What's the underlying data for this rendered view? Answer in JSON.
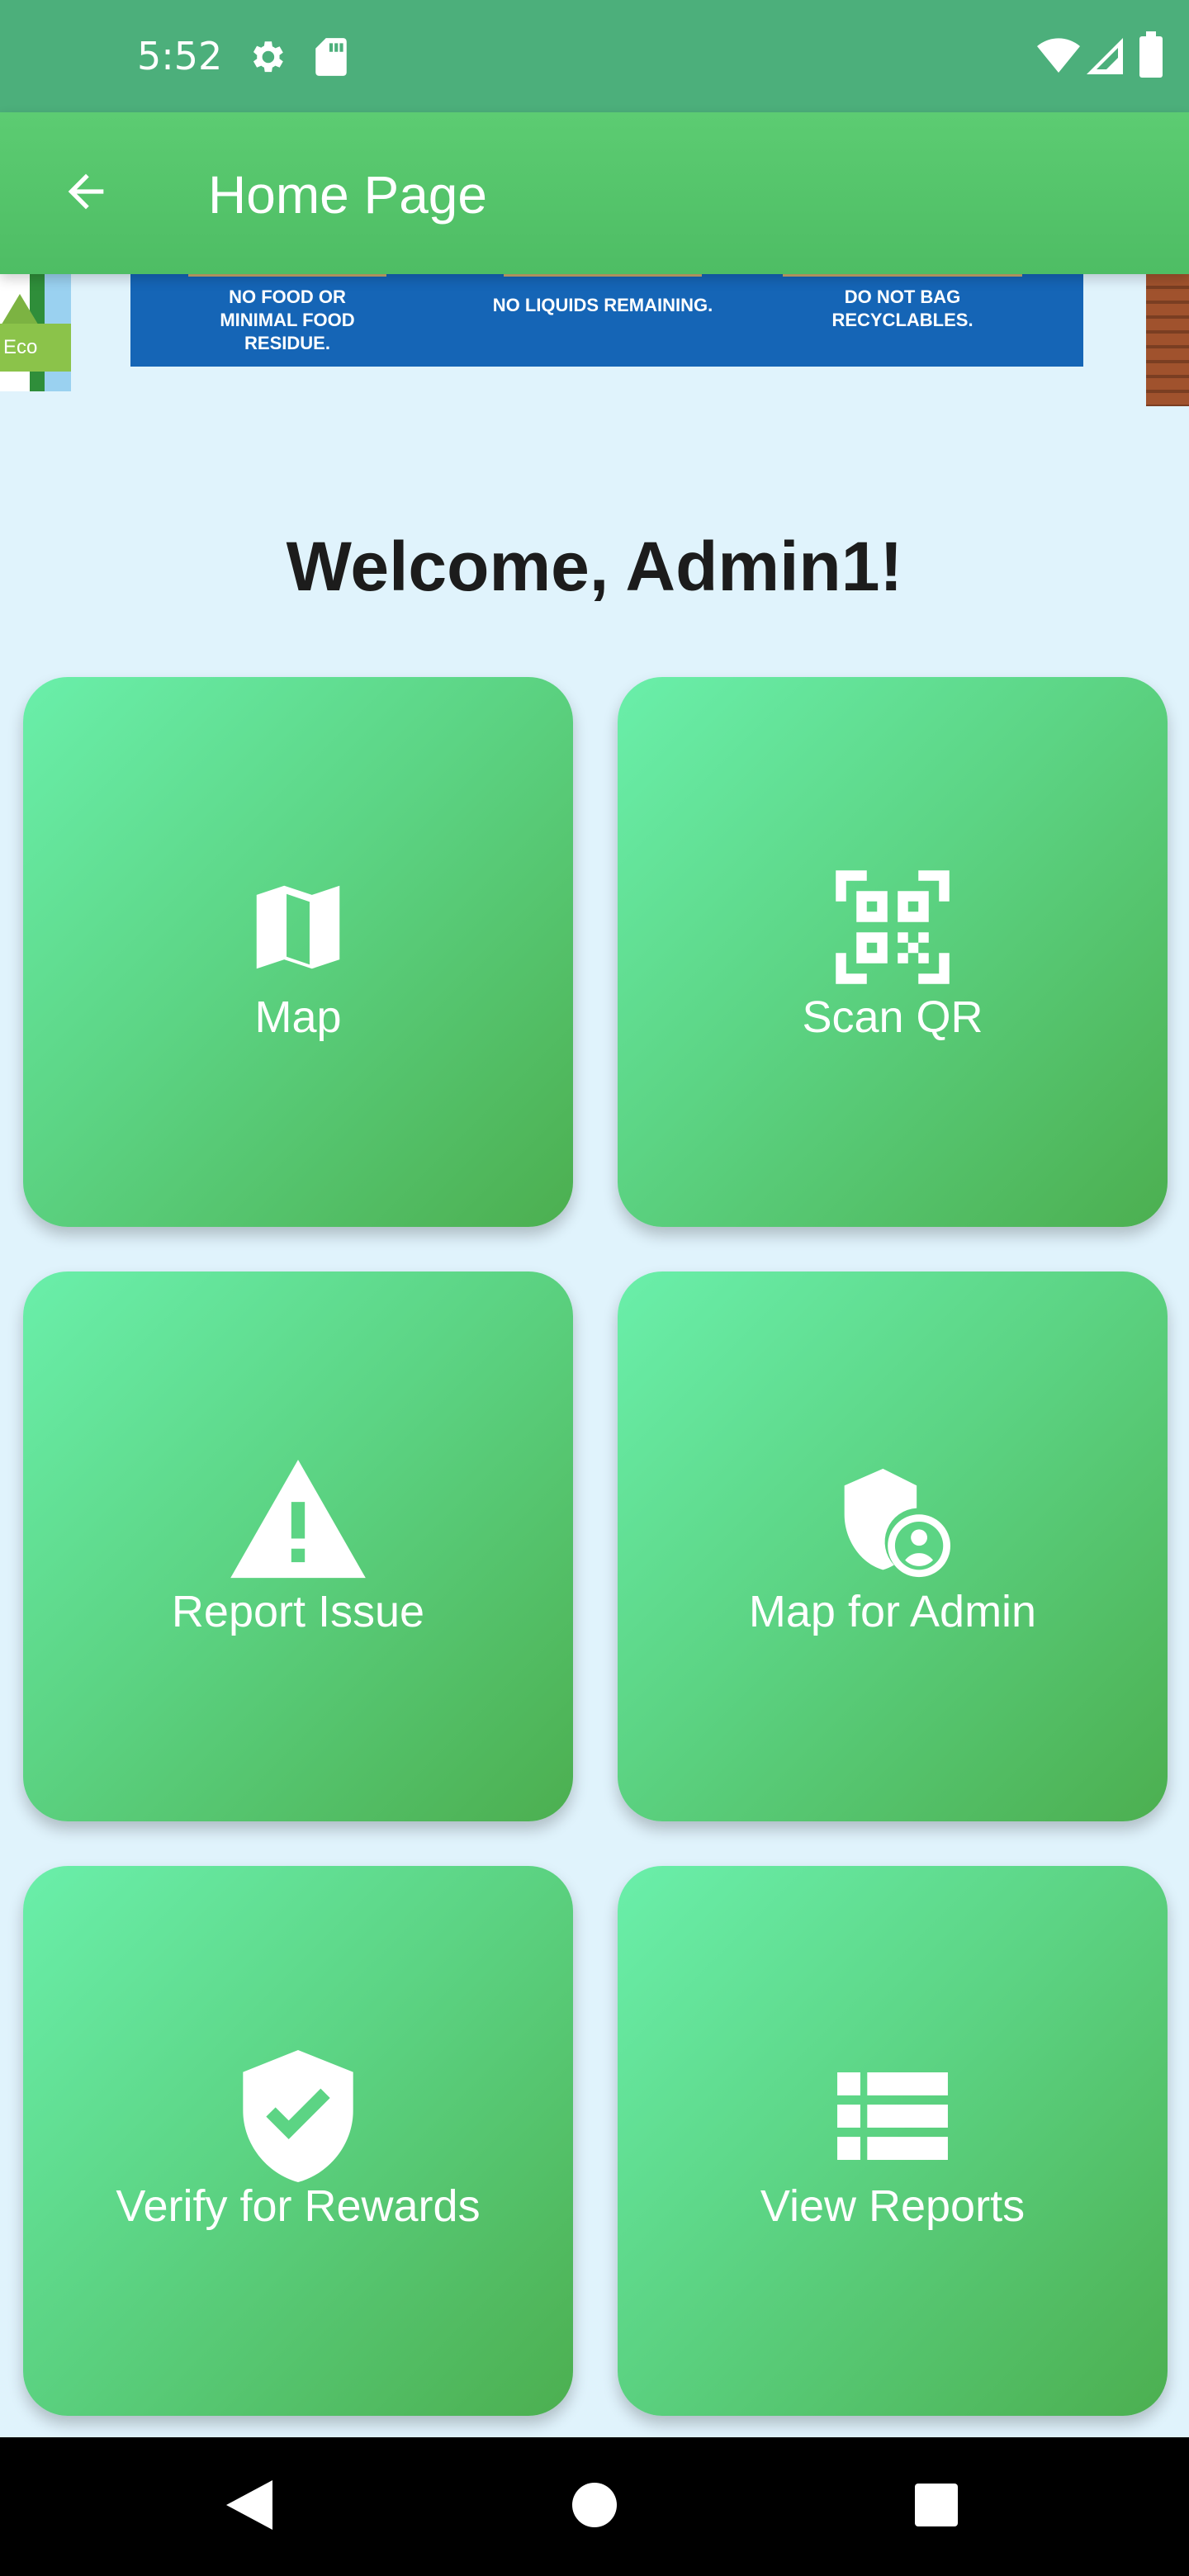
{
  "status_bar": {
    "time": "5:52",
    "icons": [
      "gear-icon",
      "sd-card-icon",
      "wifi-icon",
      "signal-icon",
      "battery-icon"
    ]
  },
  "app_bar": {
    "back_icon": "arrow-left-icon",
    "title": "Home Page"
  },
  "banner": {
    "eco_tag": "Eco",
    "columns": [
      "NO FOOD OR MINIMAL FOOD RESIDUE.",
      "NO LIQUIDS REMAINING.",
      "DO NOT BAG RECYCLABLES."
    ]
  },
  "welcome": "Welcome, Admin1!",
  "tiles": [
    {
      "label": "Map",
      "icon": "map-icon"
    },
    {
      "label": "Scan QR",
      "icon": "qr-code-icon"
    },
    {
      "label": "Report Issue",
      "icon": "warning-icon"
    },
    {
      "label": "Map for Admin",
      "icon": "admin-shield-icon"
    },
    {
      "label": "Verify for Rewards",
      "icon": "verified-shield-icon"
    },
    {
      "label": "View Reports",
      "icon": "list-icon"
    }
  ],
  "nav_bar": {
    "buttons": [
      "back-triangle-icon",
      "home-circle-icon",
      "recents-square-icon"
    ]
  },
  "colors": {
    "status_bar": "#4caf7b",
    "app_bar": "#5ccc72",
    "background": "#e0f3fc",
    "tile_gradient_start": "#6aefaa",
    "tile_gradient_end": "#4caf50",
    "banner_blue": "#1565b6"
  }
}
